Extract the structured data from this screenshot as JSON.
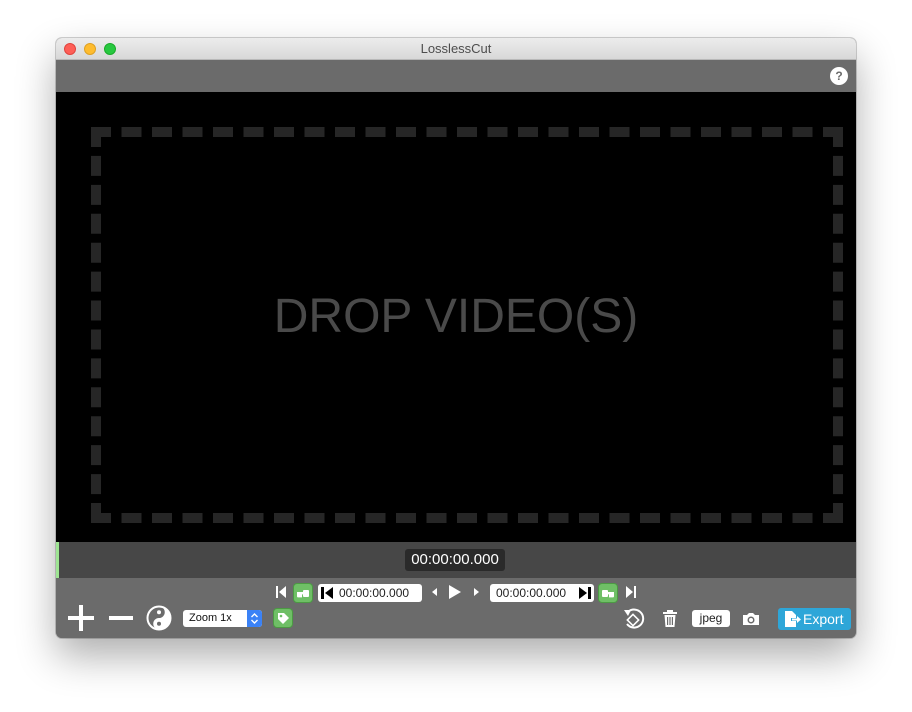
{
  "window": {
    "title": "LosslessCut"
  },
  "topbar": {
    "help_label": "?"
  },
  "player": {
    "drop_text": "DROP VIDEO(S)"
  },
  "timeline": {
    "current_time": "00:00:00.000"
  },
  "controls": {
    "cut_start_time": "00:00:00.000",
    "cut_end_time": "00:00:00.000",
    "zoom_selected": "Zoom 1x",
    "capture_format": "jpeg",
    "export_label": "Export"
  },
  "colors": {
    "accent_green": "#6fbf66",
    "export_blue": "#2ea6d8",
    "panel_gray": "#6b6b6b",
    "timeline_gray": "#474747"
  },
  "icons": [
    "help-icon",
    "add-segment-icon",
    "remove-segment-icon",
    "invert-segments-icon",
    "tag-icon",
    "jump-start-icon",
    "set-cut-start-icon",
    "jump-cut-start-icon",
    "step-back-icon",
    "play-icon",
    "step-forward-icon",
    "jump-cut-end-icon",
    "set-cut-end-icon",
    "jump-end-icon",
    "rotate-icon",
    "trash-icon",
    "camera-icon",
    "export-icon"
  ]
}
